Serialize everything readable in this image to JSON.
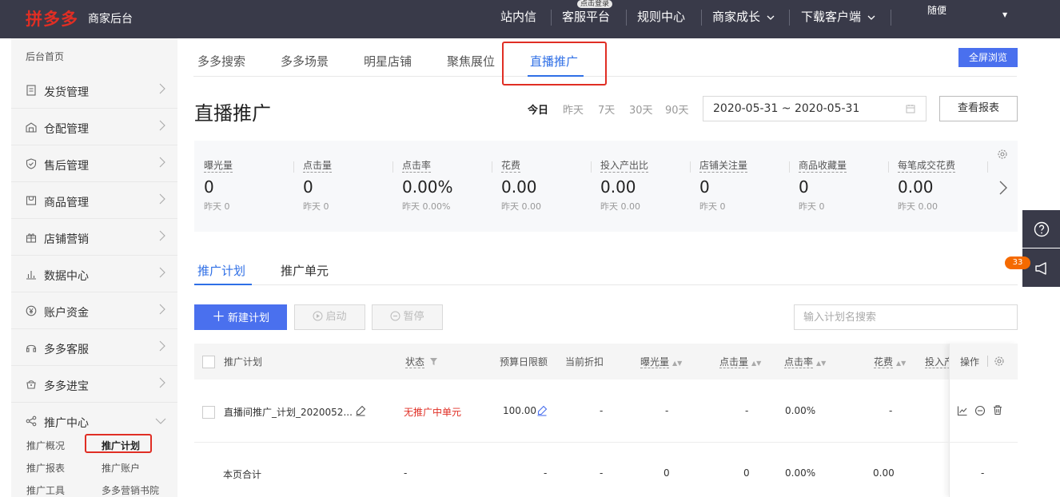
{
  "topbar": {
    "brand": "拼多多",
    "brand_sub": "商家后台",
    "nav": [
      "站内信",
      "客服平台",
      "规则中心",
      "商家成长",
      "下载客户端"
    ],
    "tip_badge": "点击登录",
    "user": "随便"
  },
  "sidebar": {
    "home": "后台首页",
    "items": [
      {
        "label": "发货管理",
        "icon": "document-icon"
      },
      {
        "label": "仓配管理",
        "icon": "warehouse-icon"
      },
      {
        "label": "售后管理",
        "icon": "shield-icon"
      },
      {
        "label": "商品管理",
        "icon": "product-icon"
      },
      {
        "label": "店铺营销",
        "icon": "gift-icon"
      },
      {
        "label": "数据中心",
        "icon": "bar-chart-icon"
      },
      {
        "label": "账户资金",
        "icon": "yen-icon"
      },
      {
        "label": "多多客服",
        "icon": "headset-icon"
      },
      {
        "label": "多多进宝",
        "icon": "treasure-icon"
      },
      {
        "label": "推广中心",
        "icon": "share-icon"
      }
    ],
    "sub_links": [
      "推广概况",
      "推广计划",
      "推广报表",
      "推广账户",
      "推广工具",
      "多多营销书院"
    ]
  },
  "main_tabs": [
    "多多搜索",
    "多多场景",
    "明星店铺",
    "聚焦展位",
    "直播推广"
  ],
  "fullscreen_label": "全屏浏览",
  "page_title": "直播推广",
  "date_buttons": [
    "今日",
    "昨天",
    "7天",
    "30天",
    "90天"
  ],
  "date_range": "2020-05-31 ~ 2020-05-31",
  "report_button": "查看报表",
  "metrics": [
    {
      "label": "曝光量",
      "value": "0",
      "yesterday": "昨天 0"
    },
    {
      "label": "点击量",
      "value": "0",
      "yesterday": "昨天 0"
    },
    {
      "label": "点击率",
      "value": "0.00%",
      "yesterday": "昨天 0.00%"
    },
    {
      "label": "花费",
      "value": "0.00",
      "yesterday": "昨天 0.00"
    },
    {
      "label": "投入产出比",
      "value": "0.00",
      "yesterday": "昨天 0.00"
    },
    {
      "label": "店铺关注量",
      "value": "0",
      "yesterday": "昨天 0"
    },
    {
      "label": "商品收藏量",
      "value": "0",
      "yesterday": "昨天 0"
    },
    {
      "label": "每笔成交花费",
      "value": "0.00",
      "yesterday": "昨天 0.00"
    }
  ],
  "notice_count": "33",
  "sub_tabs": [
    "推广计划",
    "推广单元"
  ],
  "toolbar": {
    "new_plan": "新建计划",
    "start": "启动",
    "pause": "暂停",
    "search_placeholder": "输入计划名搜索"
  },
  "table": {
    "headers": [
      "推广计划",
      "状态",
      "预算日限额",
      "当前折扣",
      "曝光量",
      "点击量",
      "点击率",
      "花费",
      "投入产",
      "操作"
    ],
    "row": {
      "name": "直播间推广_计划_2020052...",
      "status": "无推广中单元",
      "budget": "100.00",
      "discount": "-",
      "impressions": "-",
      "clicks": "-",
      "ctr": "0.00%",
      "cost": "-"
    },
    "total": {
      "label": "本页合计",
      "status": "-",
      "budget": "-",
      "discount": "-",
      "impressions": "0",
      "clicks": "0",
      "ctr": "0.00%",
      "cost": "0.00",
      "ops": "-"
    }
  },
  "colors": {
    "topbar_bg": "#393a49",
    "brand_red": "#e02e24",
    "primary_blue": "#4a70ee",
    "status_red": "#e02e24",
    "highlight_box": "#e02e24"
  }
}
